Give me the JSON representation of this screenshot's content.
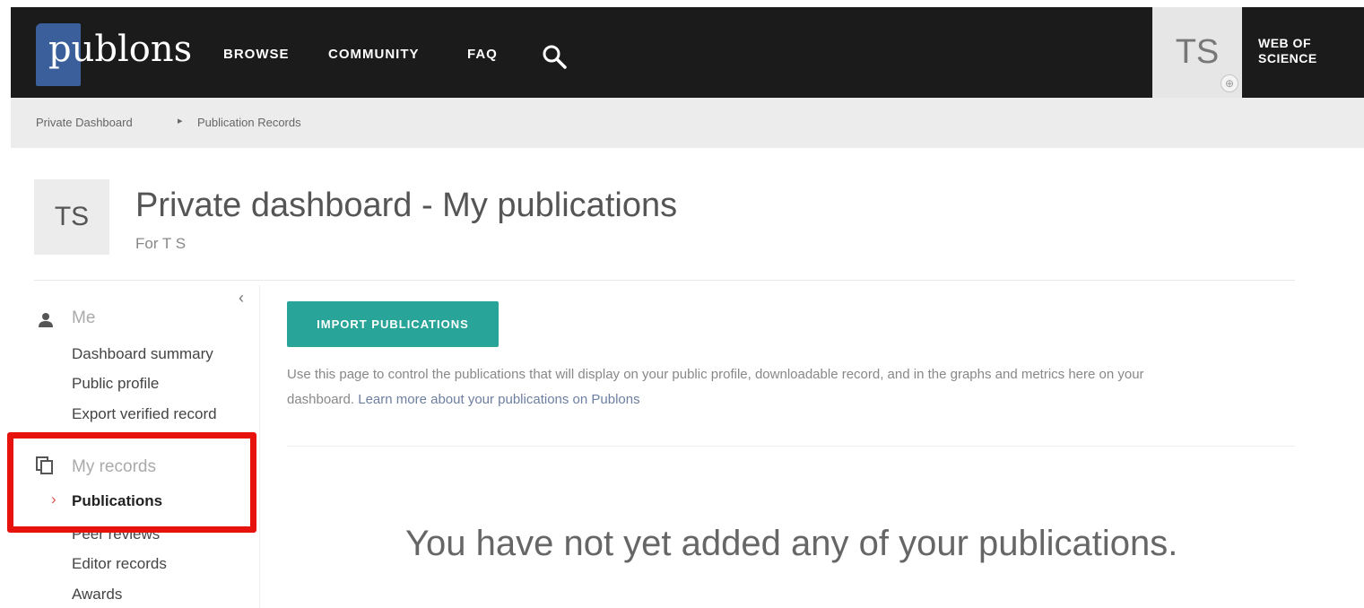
{
  "topnav": {
    "logo_text": "publons",
    "links": [
      "BROWSE",
      "COMMUNITY",
      "FAQ"
    ],
    "avatar_initials": "TS",
    "avatar_badge": "⊕",
    "wos_line1": "WEB OF",
    "wos_line2": "SCIENCE"
  },
  "breadcrumb": {
    "items": [
      "Private Dashboard",
      "Publication Records"
    ],
    "separator": "▸"
  },
  "header": {
    "avatar_initials": "TS",
    "title": "Private dashboard - My publications",
    "subtitle": "For T S"
  },
  "sidebar": {
    "collapse_glyph": "‹",
    "me_section": "Me",
    "me_items": [
      "Dashboard summary",
      "Public profile",
      "Export verified record"
    ],
    "records_section": "My records",
    "records_items": [
      "Publications",
      "Peer reviews",
      "Editor records",
      "Awards"
    ],
    "active_chevron": "›"
  },
  "main": {
    "import_button": "IMPORT PUBLICATIONS",
    "help_text": "Use this page to control the publications that will display on your public profile, downloadable record, and in the graphs and metrics here on your dashboard.",
    "help_link": "Learn more about your publications on Publons",
    "empty_message": "You have not yet added any of your publications."
  },
  "colors": {
    "topbar": "#1b1b1b",
    "accent_teal": "#28a499",
    "highlight_red": "#e8120c",
    "logo_blue": "#3b5f9b"
  }
}
